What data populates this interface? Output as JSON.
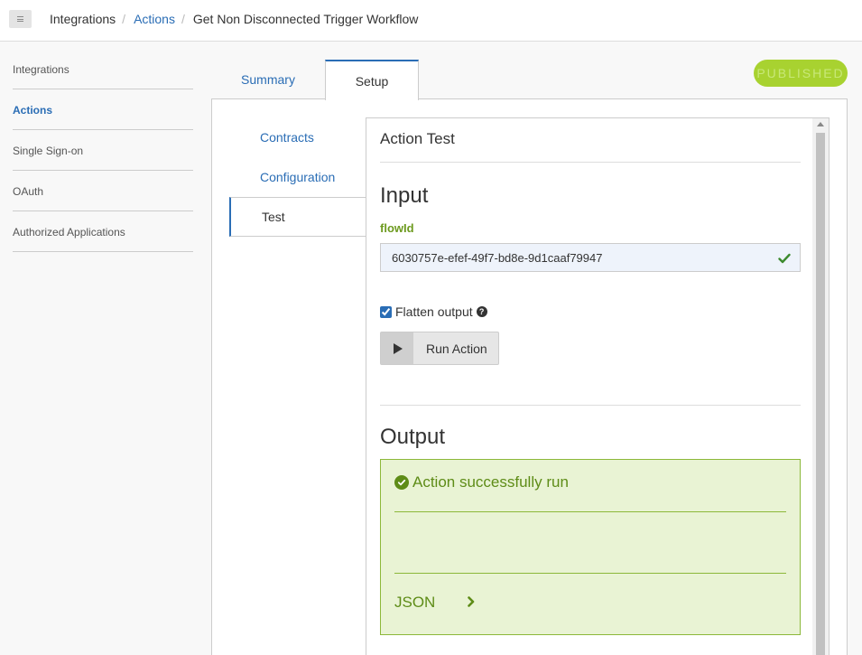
{
  "breadcrumb": {
    "items": [
      "Integrations",
      "Actions",
      "Get Non Disconnected Trigger Workflow"
    ],
    "separator": "/"
  },
  "sidebar": {
    "items": [
      {
        "label": "Integrations"
      },
      {
        "label": "Actions"
      },
      {
        "label": "Single Sign-on"
      },
      {
        "label": "OAuth"
      },
      {
        "label": "Authorized Applications"
      }
    ]
  },
  "tabs": {
    "summary": "Summary",
    "setup": "Setup"
  },
  "status_badge": "PUBLISHED",
  "subnav": {
    "items": [
      {
        "label": "Contracts"
      },
      {
        "label": "Configuration"
      },
      {
        "label": "Test"
      }
    ]
  },
  "test": {
    "title": "Action Test",
    "input_heading": "Input",
    "field_label": "flowId",
    "field_value": "6030757e-efef-49f7-bd8e-9d1caaf79947",
    "flatten_label": "Flatten output",
    "flatten_checked": true,
    "run_label": "Run Action",
    "output_heading": "Output",
    "success_message": "Action successfully run",
    "json_label": "JSON"
  },
  "colors": {
    "accent": "#2a6db5",
    "success": "#5e8c17",
    "badge": "#a8d230"
  }
}
